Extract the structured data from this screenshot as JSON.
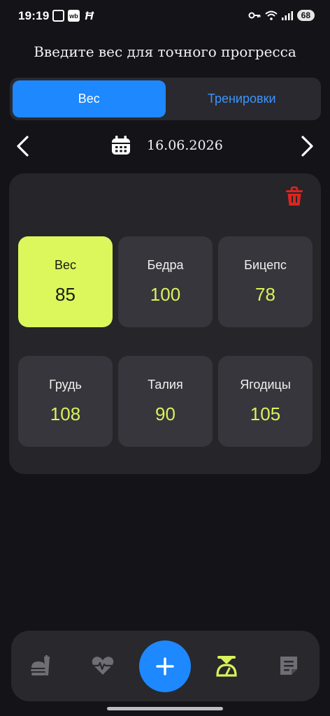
{
  "status_bar": {
    "time": "19:19",
    "app_badge": "wb",
    "battery": "68"
  },
  "header": {
    "title": "Введите вес для точного прогресса"
  },
  "tabs": [
    {
      "label": "Вес",
      "active": true
    },
    {
      "label": "Тренировки",
      "active": false
    }
  ],
  "date_nav": {
    "date": "16.06.2026"
  },
  "measurements": [
    {
      "label": "Вес",
      "value": "85",
      "highlighted": true
    },
    {
      "label": "Бедра",
      "value": "100",
      "highlighted": false
    },
    {
      "label": "Бицепс",
      "value": "78",
      "highlighted": false
    },
    {
      "label": "Грудь",
      "value": "108",
      "highlighted": false
    },
    {
      "label": "Талия",
      "value": "90",
      "highlighted": false
    },
    {
      "label": "Ягодицы",
      "value": "105",
      "highlighted": false
    }
  ],
  "bottom_nav": {
    "items": [
      {
        "icon": "food-icon",
        "active": false
      },
      {
        "icon": "heart-pulse-icon",
        "active": false
      },
      {
        "icon": "plus-icon",
        "active": false
      },
      {
        "icon": "scale-icon",
        "active": true
      },
      {
        "icon": "notes-icon",
        "active": false
      }
    ]
  },
  "colors": {
    "background": "#141317",
    "card": "#262529",
    "cell": "#37363c",
    "accent_blue": "#1e88ff",
    "accent_lime": "#dbf75c",
    "value_lime": "#d9f25a",
    "delete_red": "#e0231f"
  }
}
